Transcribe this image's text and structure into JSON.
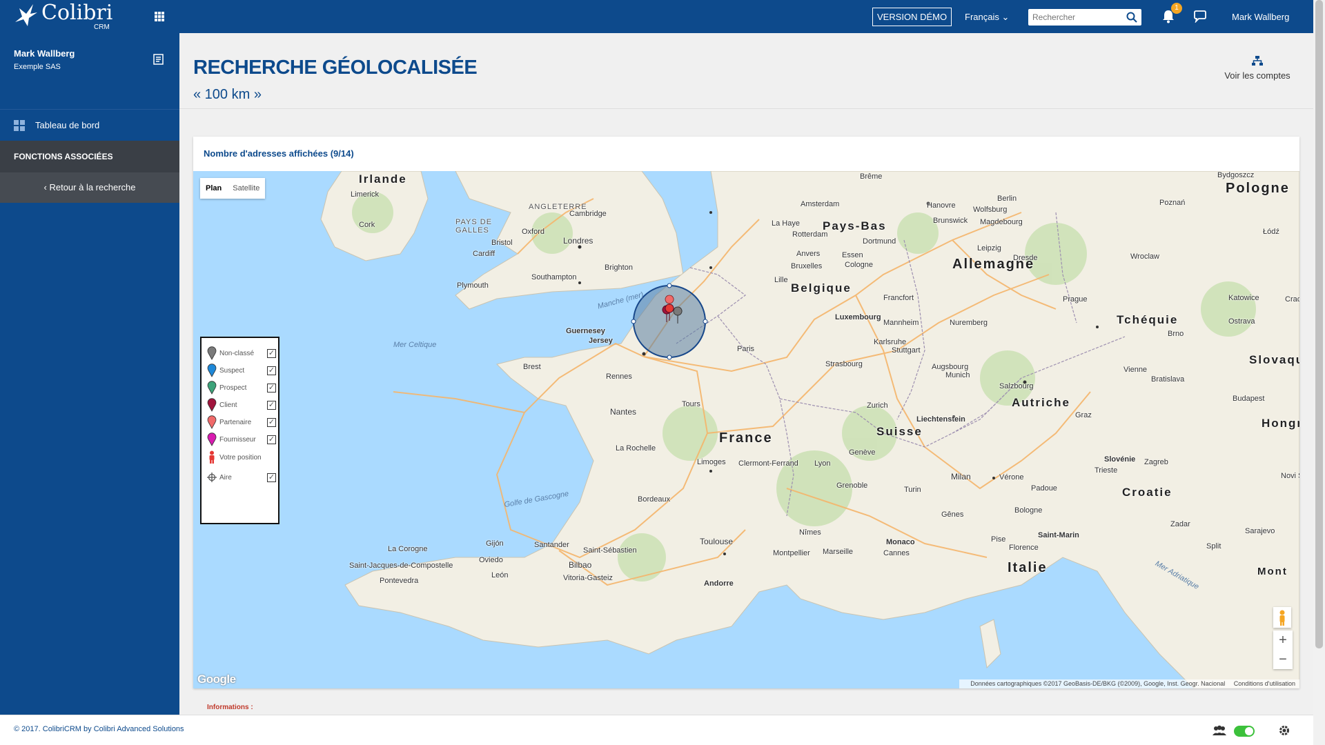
{
  "app": {
    "brand": "Colibri",
    "brand_sub": "CRM"
  },
  "topbar": {
    "demo_label": "VERSION DÉMO",
    "language": "Français",
    "search_placeholder": "Rechercher",
    "notifications_count": "1",
    "user_name": "Mark Wallberg"
  },
  "sidebar": {
    "user_name": "Mark Wallberg",
    "company": "Exemple SAS",
    "dashboard_label": "Tableau de bord",
    "section_label": "FONCTIONS ASSOCIÉES",
    "back_label": "Retour à la recherche"
  },
  "page": {
    "title": "RECHERCHE GÉOLOCALISÉE",
    "subtitle": "« 100 km »",
    "accounts_link": "Voir les comptes"
  },
  "panel": {
    "heading": "Nombre d'adresses affichées (9/14)"
  },
  "map": {
    "type_plan": "Plan",
    "type_satellite": "Satellite",
    "zoom_in": "+",
    "zoom_out": "−",
    "google": "Google",
    "attribution": "Données cartographiques ©2017 GeoBasis-DE/BKG (©2009), Google, Inst. Geogr. Nacional",
    "terms": "Conditions d'utilisation",
    "legend": [
      {
        "label": "Non-classé",
        "color": "#7a7a7a",
        "checked": true
      },
      {
        "label": "Suspect",
        "color": "#1e88d8",
        "checked": true
      },
      {
        "label": "Prospect",
        "color": "#3da37a",
        "checked": true
      },
      {
        "label": "Client",
        "color": "#a0143c",
        "checked": true
      },
      {
        "label": "Partenaire",
        "color": "#f06a6a",
        "checked": true
      },
      {
        "label": "Fournisseur",
        "color": "#d81bb0",
        "checked": true
      },
      {
        "label": "Votre position",
        "color": "#e53935",
        "checked": null
      },
      {
        "label": "Aire",
        "color": "#555555",
        "checked": true
      }
    ],
    "labels": {
      "irlande": "Irlande",
      "limerick": "Limerick",
      "cork": "Cork",
      "pays_de_galles": "PAYS DE GALLES",
      "angleterre": "ANGLETERRE",
      "cambridge": "Cambridge",
      "oxford": "Oxford",
      "londres": "Londres",
      "bristol": "Bristol",
      "cardiff": "Cardiff",
      "southampton": "Southampton",
      "brighton": "Brighton",
      "plymouth": "Plymouth",
      "manche": "Manche (mer)",
      "mer_celtique": "Mer Celtique",
      "guernesey": "Guernesey",
      "jersey": "Jersey",
      "amsterdam": "Amsterdam",
      "pays_bas": "Pays-Bas",
      "la_haye": "La Haye",
      "rotterdam": "Rotterdam",
      "anvers": "Anvers",
      "bruxelles": "Bruxelles",
      "lille": "Lille",
      "belgique": "Belgique",
      "luxembourg": "Luxembourg",
      "paris": "Paris",
      "brest": "Brest",
      "rennes": "Rennes",
      "nantes": "Nantes",
      "tours": "Tours",
      "france": "France",
      "la_rochelle": "La Rochelle",
      "limoges": "Limoges",
      "clermont": "Clermont-Ferrand",
      "lyon": "Lyon",
      "geneve": "Genève",
      "grenoble": "Grenoble",
      "bordeaux": "Bordeaux",
      "golfe": "Golfe de Gascogne",
      "toulouse": "Toulouse",
      "montpellier": "Montpellier",
      "marseille": "Marseille",
      "nimes": "Nîmes",
      "monaco": "Monaco",
      "cannes": "Cannes",
      "andorre": "Andorre",
      "bilbao": "Bilbao",
      "vitoria": "Vitoria-Gasteiz",
      "santander": "Santander",
      "oviedo": "Oviedo",
      "gijon": "Gijón",
      "la_corogne": "La Corogne",
      "saint_jacques": "Saint-Jacques-de-Compostelle",
      "pontevedra": "Pontevedra",
      "leon": "León",
      "saint_sebastien": "Saint-Sébastien",
      "breme": "Brême",
      "hanovre": "Hanovre",
      "berlin": "Berlin",
      "wolfsburg": "Wolfsburg",
      "brunswick": "Brunswick",
      "magdebourg": "Magdebourg",
      "dortmund": "Dortmund",
      "essen": "Essen",
      "cologne": "Cologne",
      "allemagne": "Allemagne",
      "leipzig": "Leipzig",
      "dresde": "Dresde",
      "francfort": "Francfort",
      "mannheim": "Mannheim",
      "nuremberg": "Nuremberg",
      "karlsruhe": "Karlsruhe",
      "stuttgart": "Stuttgart",
      "strasbourg": "Strasbourg",
      "augsbourg": "Augsbourg",
      "munich": "Munich",
      "zurich": "Zurich",
      "suisse": "Suisse",
      "liechtenstein": "Liechtenstein",
      "salzbourg": "Salzbourg",
      "autriche": "Autriche",
      "graz": "Graz",
      "vienne": "Vienne",
      "bratislava": "Bratislava",
      "slovaquie": "Slovaqu",
      "budapest": "Budapest",
      "hongrie": "Hongri",
      "tcheque": "Tchéquie",
      "prague": "Prague",
      "brno": "Brno",
      "ostrava": "Ostrava",
      "katowice": "Katowice",
      "cracovie": "Crac",
      "wroclaw": "Wroclaw",
      "pologne": "Pologne",
      "poznan": "Poznań",
      "lodz": "Łódź",
      "bydgoszcz": "Bydgoszcz",
      "milan": "Milan",
      "turin": "Turin",
      "verone": "Vérone",
      "padoue": "Padoue",
      "genes": "Gênes",
      "bologne": "Bologne",
      "florence": "Florence",
      "pise": "Pise",
      "italie": "Italie",
      "saint_marin": "Saint-Marin",
      "trieste": "Trieste",
      "slovenie": "Slovénie",
      "zagreb": "Zagreb",
      "croatie": "Croatie",
      "zadar": "Zadar",
      "split": "Split",
      "sarajevo": "Sarajevo",
      "novi": "Novi S",
      "monte": "Mont",
      "mer_adriatique": "Mer Adriatique"
    }
  },
  "footer": {
    "copyright": "© 2017. ColibriCRM by Colibri Advanced Solutions",
    "info_label": "Informations :"
  }
}
